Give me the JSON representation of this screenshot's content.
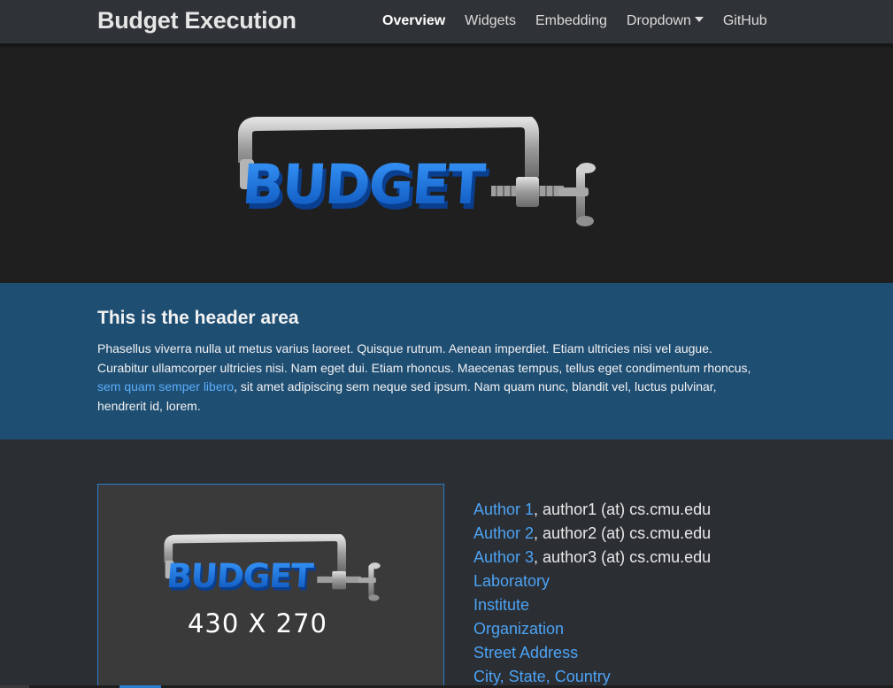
{
  "navbar": {
    "brand": "Budget Execution",
    "links": [
      {
        "label": "Overview",
        "active": true
      },
      {
        "label": "Widgets"
      },
      {
        "label": "Embedding"
      },
      {
        "label": "Dropdown"
      },
      {
        "label": "GitHub"
      }
    ]
  },
  "hero": {
    "logo_word": "BUDGET"
  },
  "header_area": {
    "title": "This is the header area",
    "text_before_link": "Phasellus viverra nulla ut metus varius laoreet. Quisque rutrum. Aenean imperdiet. Etiam ultricies nisi vel augue. Curabitur ullamcorper ultricies nisi. Nam eget dui. Etiam rhoncus. Maecenas tempus, tellus eget condimentum rhoncus, ",
    "link_text": "sem quam semper libero",
    "text_after_link": ", sit amet adipiscing sem neque sed ipsum. Nam quam nunc, blandit vel, luctus pulvinar, hendrerit id, lorem."
  },
  "thumbnail": {
    "logo_word": "BUDGET",
    "caption": "430 X 270"
  },
  "authors": [
    {
      "name": "Author 1",
      "email": ", author1 (at) cs.cmu.edu"
    },
    {
      "name": "Author 2",
      "email": ", author2 (at) cs.cmu.edu"
    },
    {
      "name": "Author 3",
      "email": ", author3 (at) cs.cmu.edu"
    }
  ],
  "affiliation": {
    "laboratory": "Laboratory",
    "institute": "Institute",
    "organization": "Organization",
    "street": "Street Address",
    "city": "City, State, Country"
  },
  "colors": {
    "navbar_bg": "#2f3236",
    "hero_bg": "#1f1f1f",
    "header_bg": "#1f4e73",
    "link": "#4ca3f5",
    "logo_blue": "#1f7fe8"
  }
}
